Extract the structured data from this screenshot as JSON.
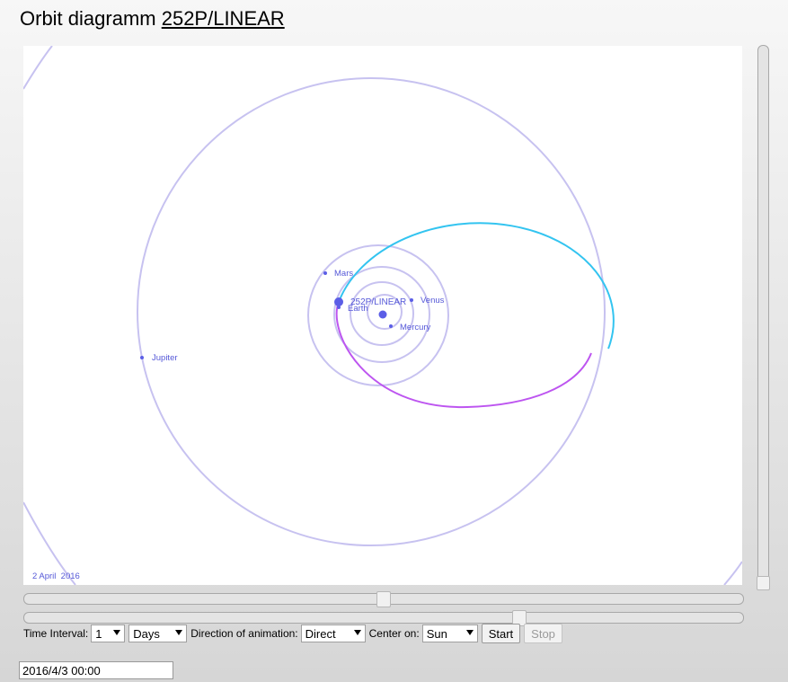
{
  "header": {
    "title_prefix": "Orbit diagramm",
    "title_link": "252P/LINEAR"
  },
  "diagram": {
    "date_label": "2 April  2016",
    "colors": {
      "orbit": "#c7c2f0",
      "body": "#5b5ee6",
      "label": "#5659d8",
      "comet_orbit_above": "#33c4f0",
      "comet_orbit_below": "#bd55f0",
      "sun": "#5b5ee6"
    },
    "sun_label": "",
    "planets": [
      {
        "name": "Mercury",
        "label": "Mercury"
      },
      {
        "name": "Venus",
        "label": "Venus"
      },
      {
        "name": "Earth",
        "label": "Earth"
      },
      {
        "name": "Mars",
        "label": "Mars"
      },
      {
        "name": "Jupiter",
        "label": "Jupiter"
      }
    ],
    "comet": {
      "label": "252P/LINEAR"
    }
  },
  "controls": {
    "time_interval_label": "Time Interval:",
    "time_interval_value": "1",
    "time_unit_value": "Days",
    "direction_label": "Direction of animation:",
    "direction_value": "Direct",
    "center_on_label": "Center on:",
    "center_on_value": "Sun",
    "start_label": "Start",
    "stop_label": "Stop"
  },
  "date_input": {
    "value": "2016/4/3 00:00"
  }
}
